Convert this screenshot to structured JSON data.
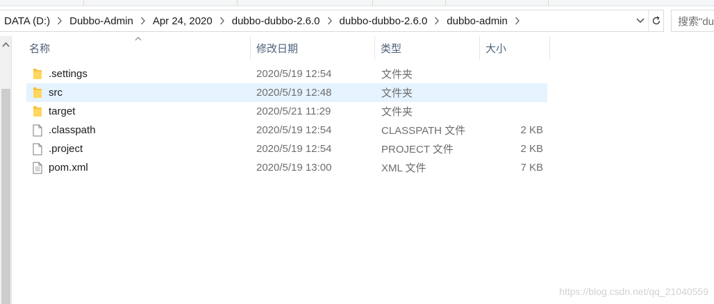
{
  "breadcrumbs": [
    "DATA (D:)",
    "Dubbo-Admin",
    "Apr 24, 2020",
    "dubbo-dubbo-2.6.0",
    "dubbo-dubbo-2.6.0",
    "dubbo-admin"
  ],
  "search": {
    "placeholder": "搜索\"du"
  },
  "columns": {
    "name": "名称",
    "date": "修改日期",
    "type": "类型",
    "size": "大小"
  },
  "files": [
    {
      "name": ".settings",
      "date": "2020/5/19 12:54",
      "type": "文件夹",
      "size": "",
      "icon": "folder-icon"
    },
    {
      "name": "src",
      "date": "2020/5/19 12:48",
      "type": "文件夹",
      "size": "",
      "icon": "folder-icon",
      "selected": true
    },
    {
      "name": "target",
      "date": "2020/5/21 11:29",
      "type": "文件夹",
      "size": "",
      "icon": "folder-icon"
    },
    {
      "name": ".classpath",
      "date": "2020/5/19 12:54",
      "type": "CLASSPATH 文件",
      "size": "2 KB",
      "icon": "file-icon"
    },
    {
      "name": ".project",
      "date": "2020/5/19 12:54",
      "type": "PROJECT 文件",
      "size": "2 KB",
      "icon": "file-icon"
    },
    {
      "name": "pom.xml",
      "date": "2020/5/19 13:00",
      "type": "XML 文件",
      "size": "7 KB",
      "icon": "xml-file-icon"
    }
  ],
  "watermark": "https://blog.csdn.net/qq_21040559",
  "colors": {
    "selection": "#e5f3ff",
    "folder": "#f8c23b",
    "header_text": "#4c607a"
  }
}
